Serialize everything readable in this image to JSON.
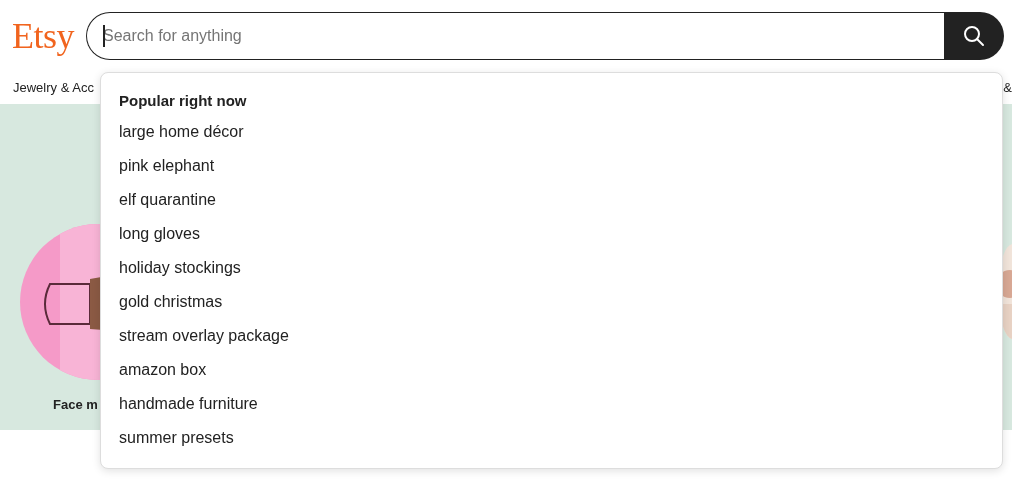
{
  "logo": "Etsy",
  "search": {
    "placeholder": "Search for anything",
    "focused": true
  },
  "categories": [
    "Jewelry & Acc",
    "&"
  ],
  "banner": {
    "items": [
      {
        "kind": "picture",
        "label": "Face m"
      }
    ]
  },
  "suggestions": {
    "heading": "Popular right now",
    "items": [
      {
        "text": "large home décor"
      },
      {
        "text": "pink elephant"
      },
      {
        "text": "elf quarantine"
      },
      {
        "text": "long gloves"
      },
      {
        "text": "holiday stockings"
      },
      {
        "text": "gold christmas"
      },
      {
        "text": "stream overlay package"
      },
      {
        "text": "amazon box"
      },
      {
        "text": "handmade furniture"
      },
      {
        "text": "summer presets"
      }
    ]
  }
}
